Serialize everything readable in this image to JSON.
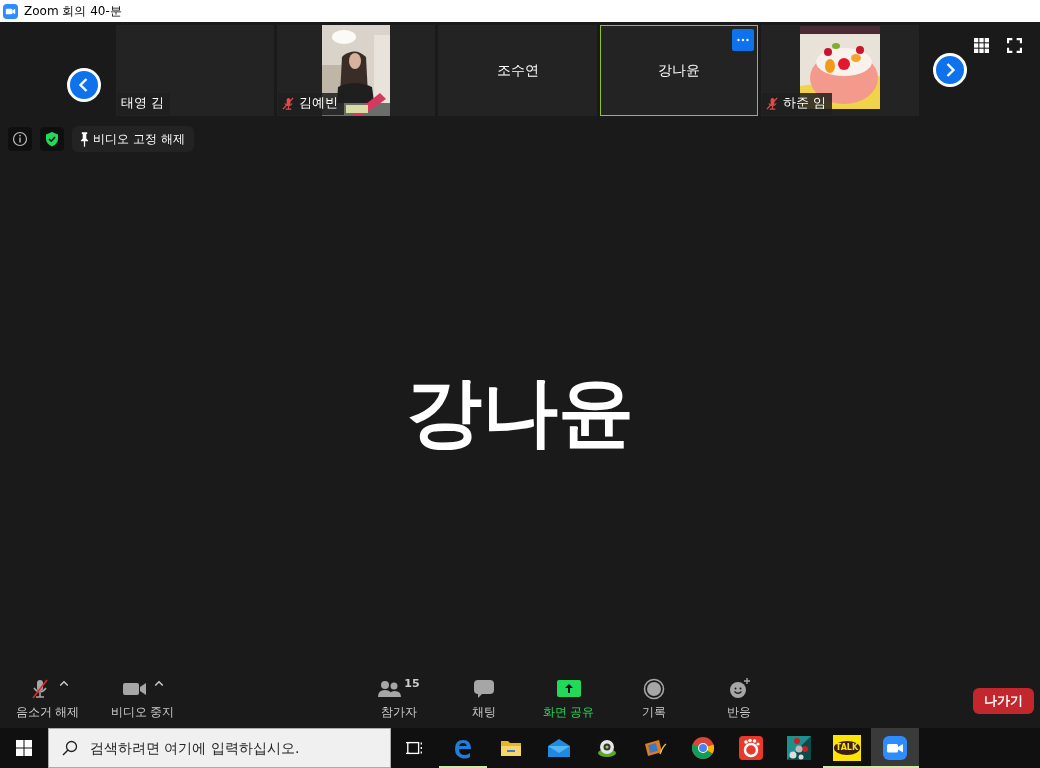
{
  "window": {
    "title": "Zoom 회의 40-분"
  },
  "tiles": [
    {
      "name": "태영 김",
      "kind": "label",
      "muted": false,
      "selected": false
    },
    {
      "name": "김예빈",
      "kind": "video",
      "muted": true,
      "selected": false
    },
    {
      "name": "조수연",
      "kind": "center",
      "selected": false
    },
    {
      "name": "강나윤",
      "kind": "center",
      "selected": true
    },
    {
      "name": "하준 임",
      "kind": "video",
      "muted": true,
      "selected": false
    }
  ],
  "pin_button": {
    "label": "비디오 고정 해제"
  },
  "speaker": {
    "name": "강나윤"
  },
  "toolbar_left": [
    {
      "kind": "mute",
      "label": "음소거 해제"
    },
    {
      "kind": "video",
      "label": "비디오 중지"
    }
  ],
  "toolbar_center": [
    {
      "kind": "participants",
      "label": "참가자",
      "badge": "15"
    },
    {
      "kind": "chat",
      "label": "채팅"
    },
    {
      "kind": "share",
      "label": "화면 공유"
    },
    {
      "kind": "record",
      "label": "기록"
    },
    {
      "kind": "reactions",
      "label": "반응"
    }
  ],
  "leave_button": {
    "label": "나가기"
  },
  "taskbar": {
    "search_placeholder": "검색하려면 여기에 입력하십시오.",
    "apps": [
      {
        "kind": "task-view",
        "running": false,
        "active": false
      },
      {
        "kind": "browser-e",
        "running": true,
        "active": false
      },
      {
        "kind": "folder",
        "running": false,
        "active": false
      },
      {
        "kind": "mail",
        "running": false,
        "active": false
      },
      {
        "kind": "webcam",
        "running": false,
        "active": false
      },
      {
        "kind": "film",
        "running": false,
        "active": false
      },
      {
        "kind": "chrome",
        "running": false,
        "active": false
      },
      {
        "kind": "paw",
        "running": false,
        "active": false
      },
      {
        "kind": "molecule",
        "running": false,
        "active": false
      },
      {
        "kind": "talk",
        "label": "TALK",
        "running": true,
        "active": false
      },
      {
        "kind": "camera",
        "running": true,
        "active": true
      }
    ]
  }
}
